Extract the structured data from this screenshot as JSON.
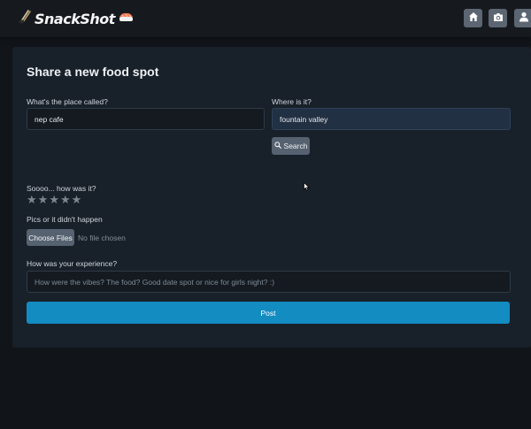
{
  "navbar": {
    "brand_name": "SnackShot",
    "brand_left_icon": "chopsticks-icon",
    "brand_right_icon": "sushi-icon",
    "buttons": [
      {
        "icon": "home-icon"
      },
      {
        "icon": "camera-icon"
      },
      {
        "icon": "user-icon"
      }
    ]
  },
  "form": {
    "title": "Share a new food spot",
    "place": {
      "label": "What's the place called?",
      "value": "nep cafe"
    },
    "location": {
      "label": "Where is it?",
      "value": "fountain valley"
    },
    "search_button": {
      "label": "Search",
      "icon": "search-icon"
    },
    "rating": {
      "label": "Soooo... how was it?",
      "star_glyph": "★",
      "max": 5,
      "value": 0
    },
    "pics": {
      "label": "Pics or it didn't happen",
      "button_label": "Choose Files",
      "status": "No file chosen"
    },
    "experience": {
      "label": "How was your experience?",
      "placeholder": "How were the vibes? The food? Good date spot or nice for girls night? :)"
    },
    "post_button": {
      "label": "Post"
    }
  },
  "colors": {
    "background": "#11151a",
    "card": "#182029",
    "accent": "#138cc1",
    "secondary_button": "#566270"
  }
}
